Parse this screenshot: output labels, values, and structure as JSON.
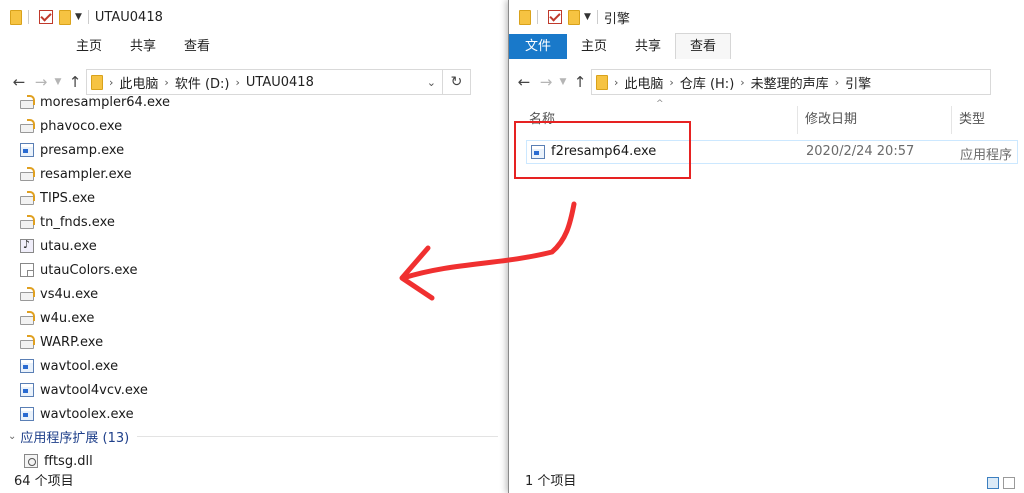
{
  "left_window": {
    "title": "UTAU0418",
    "ribbon_tabs": [
      "主页",
      "共享",
      "查看"
    ],
    "breadcrumb": [
      "此电脑",
      "软件 (D:)",
      "UTAU0418"
    ],
    "files": [
      {
        "name": "moresampler64.exe",
        "icon": "batch-file-icon"
      },
      {
        "name": "phavoco.exe",
        "icon": "batch-file-icon"
      },
      {
        "name": "presamp.exe",
        "icon": "app-exe-icon"
      },
      {
        "name": "resampler.exe",
        "icon": "batch-file-icon"
      },
      {
        "name": "TIPS.exe",
        "icon": "batch-file-icon"
      },
      {
        "name": "tn_fnds.exe",
        "icon": "batch-file-icon"
      },
      {
        "name": "utau.exe",
        "icon": "utau-note-icon"
      },
      {
        "name": "utauColors.exe",
        "icon": "blank-file-icon"
      },
      {
        "name": "vs4u.exe",
        "icon": "batch-file-icon"
      },
      {
        "name": "w4u.exe",
        "icon": "batch-file-icon"
      },
      {
        "name": "WARP.exe",
        "icon": "batch-file-icon"
      },
      {
        "name": "wavtool.exe",
        "icon": "app-exe-icon"
      },
      {
        "name": "wavtool4vcv.exe",
        "icon": "app-exe-icon"
      },
      {
        "name": "wavtoolex.exe",
        "icon": "app-exe-icon"
      }
    ],
    "group": {
      "label": "应用程序扩展 (13)"
    },
    "group_files": [
      {
        "name": "fftsg.dll",
        "icon": "dll-file-icon"
      }
    ],
    "status": "64 个项目"
  },
  "right_window": {
    "title": "引擎",
    "ribbon_tabs": [
      "文件",
      "主页",
      "共享",
      "查看"
    ],
    "breadcrumb": [
      "此电脑",
      "仓库 (H:)",
      "未整理的声库",
      "引擎"
    ],
    "columns": [
      "名称",
      "修改日期",
      "类型"
    ],
    "files": [
      {
        "name": "f2resamp64.exe",
        "date": "2020/2/24 20:57",
        "type": "应用程序",
        "icon": "app-exe-icon"
      }
    ],
    "status": "1 个项目"
  },
  "annotation": {
    "color": "#e62222",
    "arrow_direction": "right-to-left"
  },
  "colors": {
    "file_tab": "#1979ca",
    "group_header": "#1e3f8a",
    "highlight_box": "#e62222"
  }
}
